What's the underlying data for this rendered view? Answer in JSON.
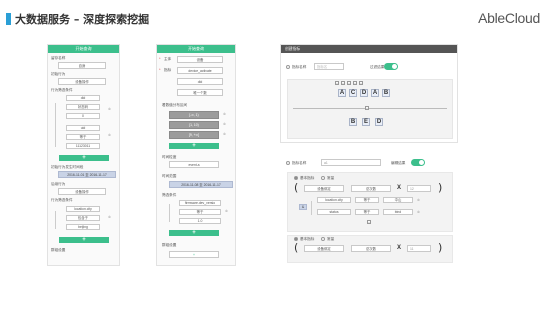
{
  "title": "大数据服务 – 深度探索挖掘",
  "logo": {
    "text": "AbleCloud"
  },
  "colors": {
    "accent": "#3cbf8c",
    "title_bar": "#2a9fd6"
  },
  "panel1": {
    "start_query": "开始查询",
    "retention_name_label": "留存名称",
    "retention_name_value": "自身",
    "initial_behavior_label": "初始行为",
    "initial_behavior_value": "设备操作",
    "filter_label": "行为筛选条件",
    "filter_rows": [
      "did",
      "状态码",
      "0",
      "uid",
      "等于"
    ],
    "filter_value": "11123011",
    "time_range_label": "初始行为发生时间段",
    "time_range_value": "2016-11-01 至 2016-11-17",
    "followup_label": "后续行为",
    "followup_value": "设备操作",
    "followup_filter_label": "行为筛选条件",
    "followup_filter_rows": [
      "location.city",
      "包含于",
      "beijing"
    ],
    "group_label": "群组设置"
  },
  "panel2": {
    "start_query": "开始查询",
    "subject_label": "主体",
    "subject_value": "设备",
    "metric_label": "指标",
    "metric_value": "device_activate",
    "metric_sub1": "did",
    "metric_sub2": "唯一个数",
    "dist_label": "看数值分布区间",
    "ranges": [
      "[-∞, 1)",
      "[1, 10)",
      "[9, +∞]"
    ],
    "time_grain_label": "时间粒度",
    "time_grain_value": "event.a",
    "time_range_label": "时间范围",
    "time_range_value": "2016-11-08 至 2016-11-17",
    "filter_label": "筛选条件",
    "filter_rows": [
      "firmware.dev_versio",
      "等于",
      "1.0"
    ],
    "group_label": "群组设置"
  },
  "panel3": {
    "header": "创建指标",
    "metric_name_label": "指标名称",
    "metric_name_placeholder": "指标名",
    "filter_toggle_label": "过滤结果",
    "letters_top": [
      "A",
      "C",
      "D",
      "A",
      "B"
    ],
    "letters_bottom": [
      "B",
      "E",
      "D"
    ]
  },
  "panel4": {
    "metric_name_label": "指标名称",
    "metric_name_placeholder": "a1",
    "filter_toggle_label": "编辑结果",
    "radio_basic": "基本指标",
    "radio_const": "常量",
    "row1": {
      "dropdown1": "设备绑定",
      "dropdown2": "总次数",
      "input": "12"
    },
    "filters": [
      {
        "field": "location.city",
        "op": "等于",
        "value": "中山"
      },
      {
        "field": "status",
        "op": "等于",
        "value": "bind"
      }
    ],
    "row2": {
      "dropdown1": "设备绑定",
      "dropdown2": "总次数",
      "input": "11"
    },
    "times": "X"
  }
}
